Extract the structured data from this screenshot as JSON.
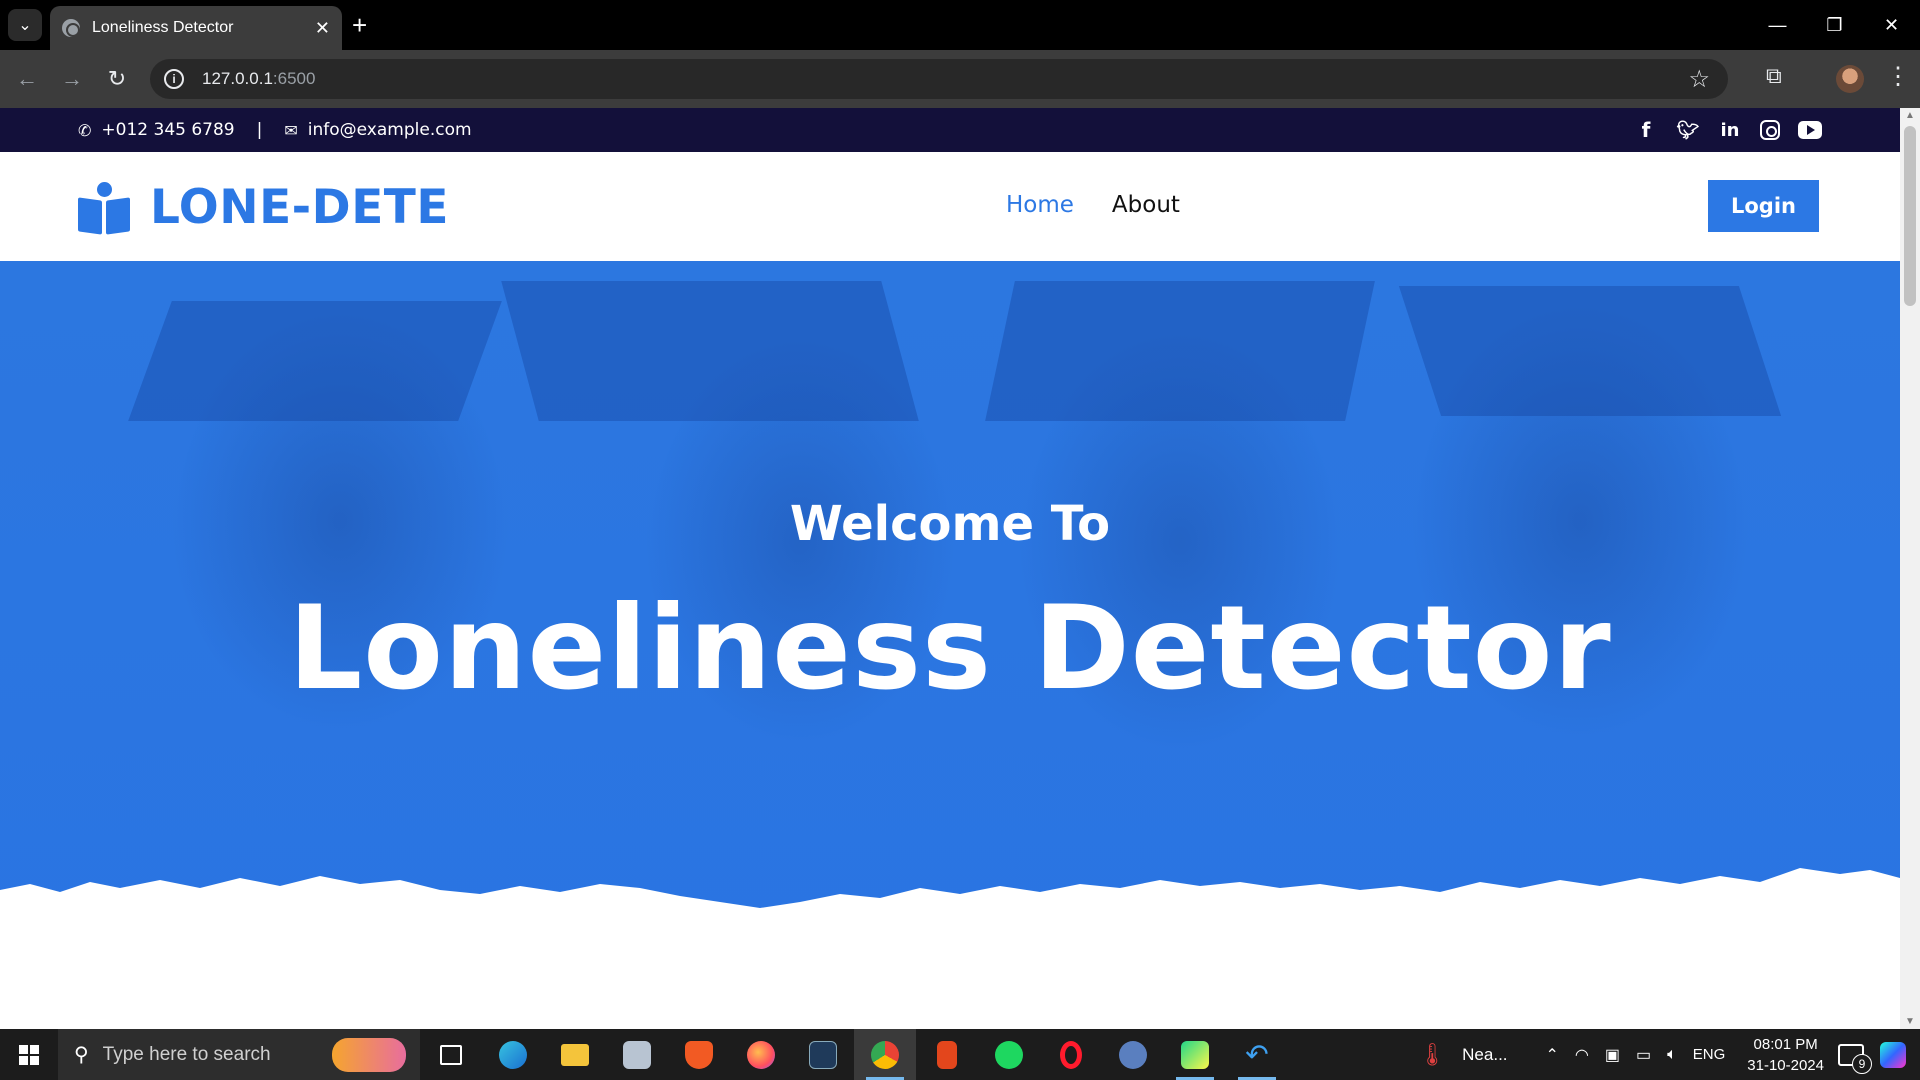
{
  "browser": {
    "tab_title": "Loneliness Detector",
    "url_host": "127.0.0.1",
    "url_port": ":6500"
  },
  "topbar": {
    "phone": "+012 345 6789",
    "separator": "|",
    "email": "info@example.com"
  },
  "navbar": {
    "logo": "LONE-DETE",
    "menu": [
      "Home",
      "About"
    ],
    "login": "Login"
  },
  "hero": {
    "subtitle": "Welcome To",
    "title": "Loneliness Detector"
  },
  "colors": {
    "brand": "#2c78e4",
    "topbar_bg": "#13103a"
  },
  "taskbar": {
    "search_placeholder": "Type here to search",
    "weather": "Nea...",
    "language": "ENG",
    "time": "08:01 PM",
    "date": "31-10-2024",
    "notification_count": "9"
  }
}
